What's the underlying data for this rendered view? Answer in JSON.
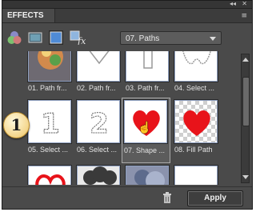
{
  "panel": {
    "tab_label": "EFFECTS",
    "window_controls": [
      "◂◂",
      "✕"
    ],
    "menu_glyph": "≡",
    "toolbar": {
      "icons": [
        "filters-icon",
        "layer-styles-icon",
        "photo-effects-icon",
        "all-effects-icon"
      ],
      "category_select": "07. Paths"
    },
    "thumbnails": [
      {
        "label": "01. Path fr...",
        "kind": "photo"
      },
      {
        "label": "02. Path fr...",
        "kind": "outline"
      },
      {
        "label": "03. Path fr...",
        "kind": "outline"
      },
      {
        "label": "04. Select ...",
        "kind": "outline"
      },
      {
        "label": "05. Select ...",
        "kind": "digit-one"
      },
      {
        "label": "06. Select ...",
        "kind": "digit-two"
      },
      {
        "label": "07. Shape ...",
        "kind": "heart-selected"
      },
      {
        "label": "08. Fill Path",
        "kind": "heart-fill"
      },
      {
        "label": "",
        "kind": "heart-stroke"
      },
      {
        "label": "",
        "kind": "cloud"
      },
      {
        "label": "",
        "kind": "photo"
      },
      {
        "label": "",
        "kind": "blank"
      }
    ],
    "apply_label": "Apply",
    "callout_number": "1",
    "colors": {
      "panel": "#4a4a4a",
      "heart": "#e8131a",
      "thumb_border": "#8fa0c0"
    }
  }
}
